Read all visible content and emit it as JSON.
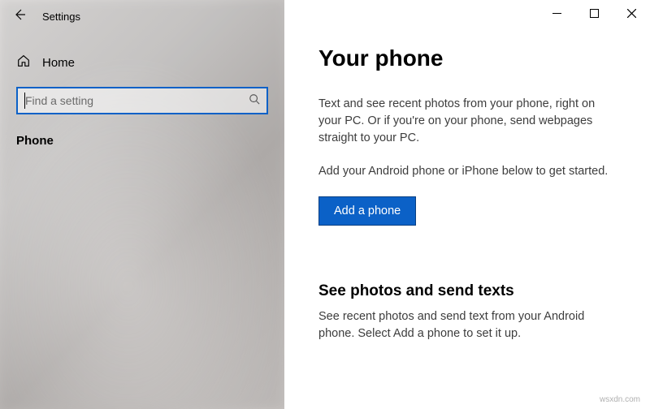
{
  "titlebar": {
    "title": "Settings"
  },
  "sidebar": {
    "home_label": "Home",
    "search_placeholder": "Find a setting",
    "nav_item": "Phone"
  },
  "main": {
    "heading": "Your phone",
    "paragraph1": "Text and see recent photos from your phone, right on your PC. Or if you're on your phone, send webpages straight to your PC.",
    "paragraph2": "Add your Android phone or iPhone below to get started.",
    "add_button": "Add a phone",
    "subheading": "See photos and send texts",
    "subparagraph": "See recent photos and send text from your Android phone. Select Add a phone to set it up."
  },
  "watermark": "wsxdn.com",
  "colors": {
    "accent": "#0b61c7"
  }
}
